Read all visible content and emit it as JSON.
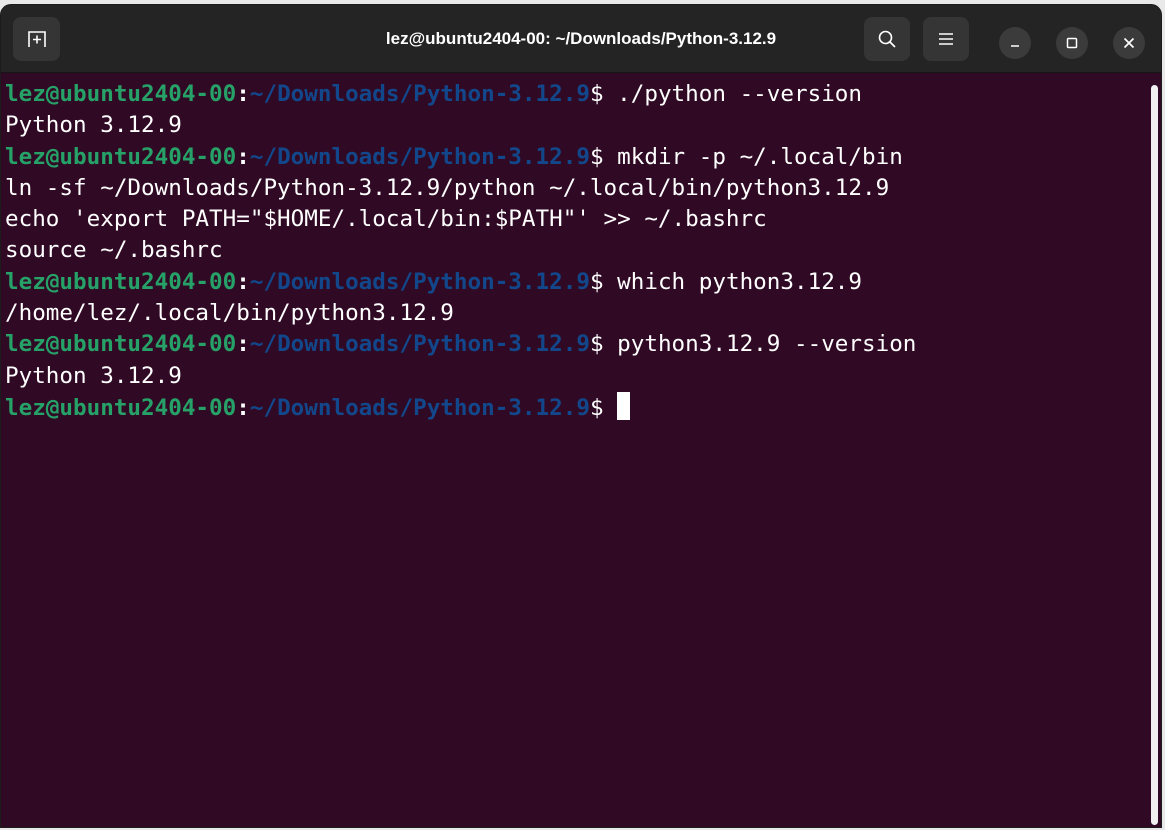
{
  "window": {
    "title": "lez@ubuntu2404-00: ~/Downloads/Python-3.12.9"
  },
  "icons": {
    "new_tab": "new-tab-icon",
    "search": "search-icon",
    "menu": "hamburger-menu-icon",
    "minimize": "minimize-icon",
    "maximize": "maximize-icon",
    "close": "close-icon"
  },
  "colors": {
    "terminal_bg": "#300a24",
    "prompt_user": "#26a269",
    "prompt_path": "#12488b",
    "text": "#ffffff",
    "titlebar": "#242424"
  },
  "terminal": {
    "prompt": {
      "user_host": "lez@ubuntu2404-00",
      "separator": ":",
      "path": "~/Downloads/Python-3.12.9",
      "symbol": "$"
    },
    "lines": [
      {
        "type": "prompt",
        "command": " ./python --version"
      },
      {
        "type": "output",
        "text": "Python 3.12.9"
      },
      {
        "type": "prompt",
        "command": " mkdir -p ~/.local/bin"
      },
      {
        "type": "output",
        "text": "ln -sf ~/Downloads/Python-3.12.9/python ~/.local/bin/python3.12.9"
      },
      {
        "type": "output",
        "text": "echo 'export PATH=\"$HOME/.local/bin:$PATH\"' >> ~/.bashrc"
      },
      {
        "type": "output",
        "text": "source ~/.bashrc"
      },
      {
        "type": "prompt",
        "command": " which python3.12.9"
      },
      {
        "type": "output",
        "text": "/home/lez/.local/bin/python3.12.9"
      },
      {
        "type": "prompt",
        "command": " python3.12.9 --version"
      },
      {
        "type": "output",
        "text": "Python 3.12.9"
      },
      {
        "type": "prompt",
        "command": " ",
        "cursor": true
      }
    ]
  }
}
